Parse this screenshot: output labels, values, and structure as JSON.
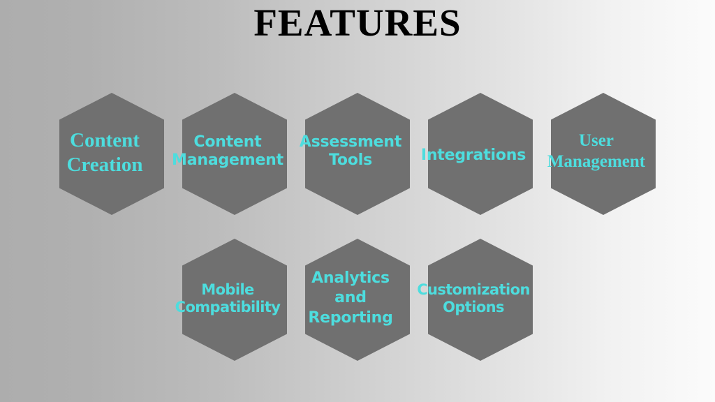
{
  "slide": {
    "title": "FEATURES",
    "background": {
      "gradient_from": "#adadad",
      "gradient_to": "#fbfbfb",
      "direction": "left-to-right"
    },
    "colors": {
      "hexagon_fill": "#707070",
      "label_text": "#4dddde",
      "title_text": "#000000"
    }
  },
  "rows": [
    {
      "name": "top-row",
      "hexagons": [
        {
          "label": "Content\nCreation",
          "font": "serif"
        },
        {
          "label": "Content\nManagement",
          "font": "sans"
        },
        {
          "label": "Assessment\nTools",
          "font": "sans"
        },
        {
          "label": "Integrations",
          "font": "sans"
        },
        {
          "label": "User\nManagement",
          "font": "serif"
        }
      ]
    },
    {
      "name": "bottom-row",
      "hexagons": [
        {
          "label": "Mobile\nCompatibility",
          "font": "sans"
        },
        {
          "label": "Analytics\nand\nReporting",
          "font": "sans"
        },
        {
          "label": "Customization\nOptions",
          "font": "sans"
        }
      ]
    }
  ]
}
